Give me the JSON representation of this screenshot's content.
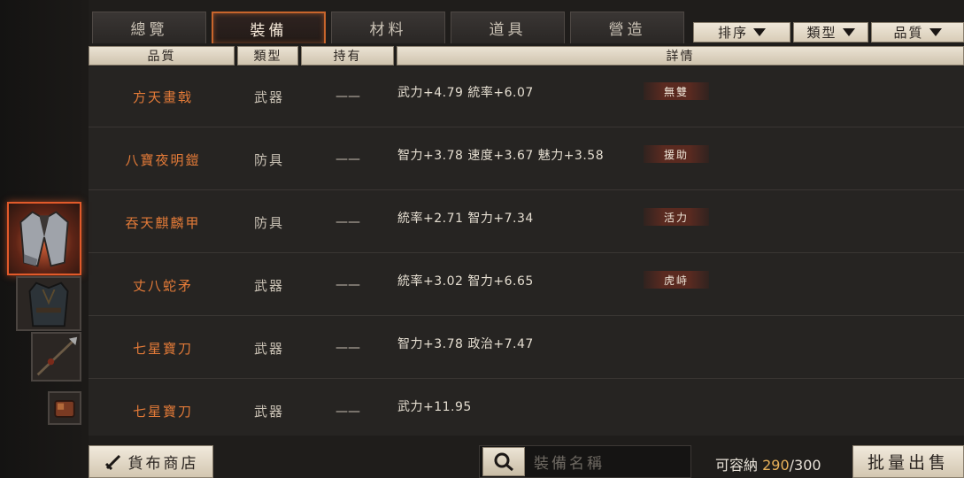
{
  "tabs": [
    {
      "label": "總覽",
      "active": false
    },
    {
      "label": "裝備",
      "active": true
    },
    {
      "label": "材料",
      "active": false
    },
    {
      "label": "道具",
      "active": false
    },
    {
      "label": "營造",
      "active": false
    }
  ],
  "filters": {
    "sort_label": "排序",
    "type_label": "類型",
    "quality_label": "品質"
  },
  "columns": {
    "quality": "品質",
    "type": "類型",
    "owned": "持有",
    "detail": "詳情"
  },
  "rows": [
    {
      "name": "方天畫戟",
      "type": "武器",
      "owned": "——",
      "detail": "武力+4.79 統率+6.07",
      "tag": "無雙"
    },
    {
      "name": "八寶夜明鎧",
      "type": "防具",
      "owned": "——",
      "detail": "智力+3.78 速度+3.67 魅力+3.58",
      "tag": "援助"
    },
    {
      "name": "吞天麒麟甲",
      "type": "防具",
      "owned": "——",
      "detail": "統率+2.71 智力+7.34",
      "tag": "活力"
    },
    {
      "name": "丈八蛇矛",
      "type": "武器",
      "owned": "——",
      "detail": "統率+3.02 智力+6.65",
      "tag": "虎峙"
    },
    {
      "name": "七星寶刀",
      "type": "武器",
      "owned": "——",
      "detail": "智力+3.78 政治+7.47",
      "tag": ""
    },
    {
      "name": "七星寶刀",
      "type": "武器",
      "owned": "——",
      "detail": "武力+11.95",
      "tag": ""
    }
  ],
  "bottom": {
    "shop_label": "貨布商店",
    "search_placeholder": "裝備名稱",
    "capacity_label": "可容納",
    "capacity_current": "290",
    "capacity_max": "/300",
    "sell_label": "批量出售"
  },
  "colors": {
    "accent": "#e27a38",
    "active_tab_border": "#c8652c",
    "capacity_highlight": "#e8b15a"
  },
  "icons": {
    "shop": "sword-icon",
    "search": "magnifier-icon"
  }
}
